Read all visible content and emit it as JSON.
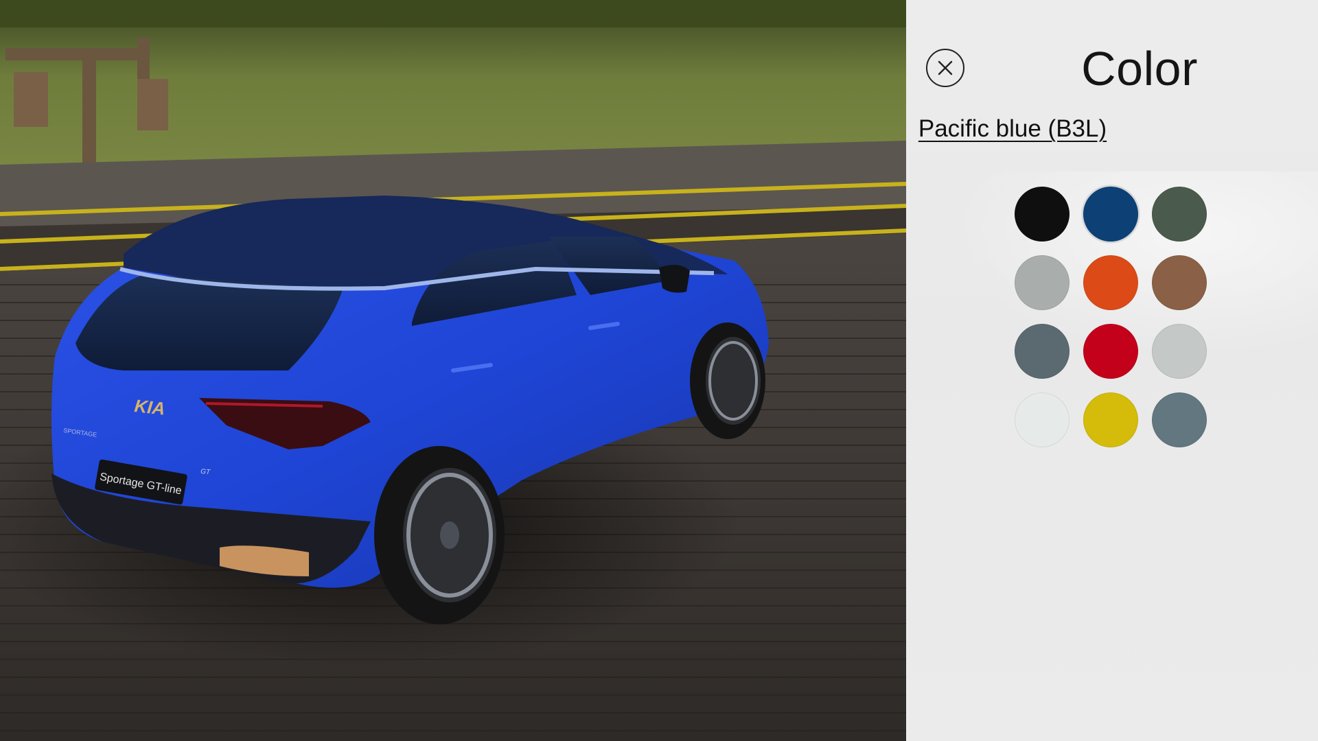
{
  "panel": {
    "title": "Color",
    "selected_color_name": "Pacific blue (B3L)",
    "close_icon": "close-icon",
    "swatches": [
      {
        "color": "#0f0f0f",
        "selected": false
      },
      {
        "color": "#0d4176",
        "selected": true
      },
      {
        "color": "#4a5a4c",
        "selected": false
      },
      {
        "color": "#a9adab",
        "selected": false
      },
      {
        "color": "#dc4b17",
        "selected": false
      },
      {
        "color": "#8a6147",
        "selected": false
      },
      {
        "color": "#5b6a70",
        "selected": false
      },
      {
        "color": "#c4011b",
        "selected": false
      },
      {
        "color": "#c4c8c6",
        "selected": false
      },
      {
        "color": "#e6ebea",
        "selected": false
      },
      {
        "color": "#d5bc0b",
        "selected": false
      },
      {
        "color": "#627780",
        "selected": false
      }
    ]
  },
  "scene": {
    "car_body_color": "#1f45d6",
    "plate_text": "Sportage GT-line",
    "brand_text": "KIA",
    "model_text": "SPORTAGE",
    "badge_text": "GT"
  }
}
